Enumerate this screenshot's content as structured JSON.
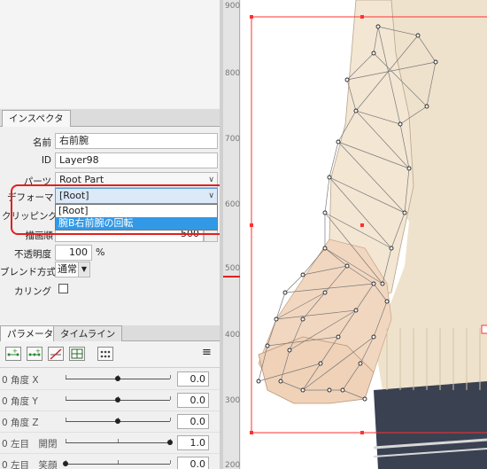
{
  "inspector": {
    "tab_label": "インスペクタ",
    "name_label": "名前",
    "name_value": "右前腕",
    "id_label": "ID",
    "id_value": "Layer98",
    "parts_label": "パーツ",
    "parts_value": "Root Part",
    "deformer_label": "デフォーマ",
    "deformer_value": "[Root]",
    "clipping_label": "クリッピング",
    "draw_order_label": "描画順",
    "draw_order_value": "500",
    "opacity_label": "不透明度",
    "opacity_value": "100",
    "opacity_unit": "%",
    "blend_label": "ブレンド方式",
    "blend_value": "通常",
    "culling_label": "カリング"
  },
  "deformer_dropdown": {
    "options": [
      "[Root]",
      "腕B右前腕の回転"
    ],
    "highlighted_index": 1
  },
  "param_panel": {
    "tabs": [
      "パラメータ",
      "タイムライン"
    ],
    "active_tab": 0,
    "rows": [
      {
        "prefix": "0",
        "name": "角度 X",
        "value": "0.0",
        "level": 0.5
      },
      {
        "prefix": "0",
        "name": "角度 Y",
        "value": "0.0",
        "level": 0.5
      },
      {
        "prefix": "0",
        "name": "角度 Z",
        "value": "0.0",
        "level": 0.5
      },
      {
        "prefix": "0",
        "name": "左目　開閉",
        "value": "1.0",
        "level": 1.0
      },
      {
        "prefix": "0",
        "name": "左目　笑顔",
        "value": "0.0",
        "level": 0.0
      }
    ]
  },
  "ruler": {
    "labels": [
      "900",
      "800",
      "700",
      "600",
      "500",
      "400",
      "300",
      "200"
    ],
    "marker_value": "500"
  },
  "colors": {
    "accent": "#3399e6",
    "highlight_red": "#e02020",
    "selection_box": "#ff3030",
    "mesh_line": "#7a7a7a",
    "skin": "#f2d7c0",
    "sweater": "#efe2cc",
    "skirt": "#3a4151"
  }
}
